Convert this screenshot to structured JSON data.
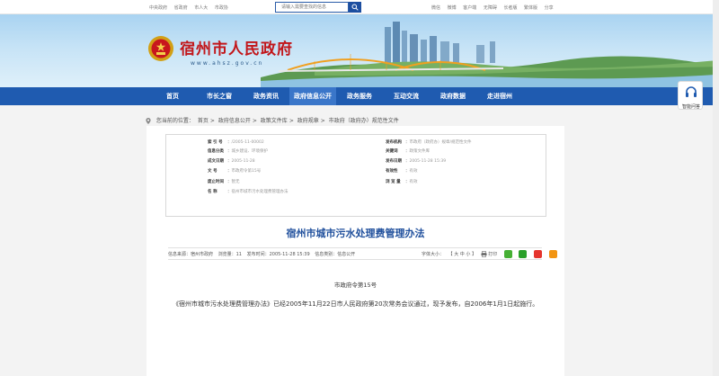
{
  "topbar": {
    "left": [
      "中央政府",
      "省政府",
      "市人大",
      "市政协"
    ],
    "search_placeholder": "请输入需要查找的信息",
    "right": [
      "微信",
      "微博",
      "客户端",
      "无障碍",
      "长者版",
      "繁体版",
      "分享"
    ]
  },
  "banner": {
    "title": "宿州市人民政府",
    "domain": "www.ahsz.gov.cn"
  },
  "nav": {
    "items": [
      "首页",
      "市长之窗",
      "政务资讯",
      "政府信息公开",
      "政务服务",
      "互动交流",
      "政府数据",
      "走进宿州"
    ],
    "active_index": 3
  },
  "float_service": {
    "label": "智能问答"
  },
  "breadcrumb": {
    "prefix": "您当前的位置：",
    "items": [
      "首页",
      "政府信息公开",
      "政策文件库",
      "政府规章",
      "市政府（政府办）规范性文件"
    ]
  },
  "meta": {
    "left": [
      {
        "k": "索 引 号",
        "v": "/2005-11-00002"
      },
      {
        "k": "信息分类",
        "v": "城乡建设、环境保护"
      },
      {
        "k": "成文日期",
        "v": "2005-11-28"
      },
      {
        "k": "文    号",
        "v": "市政府令第15号"
      },
      {
        "k": "废止时间",
        "v": "暂无"
      },
      {
        "k": "名    称",
        "v": "宿州市城市污水处理费管理办法"
      }
    ],
    "right": [
      {
        "k": "发布机构",
        "v": "市政府（政府办）规章/规范性文件"
      },
      {
        "k": "关键词",
        "v": "政策文件库"
      },
      {
        "k": "发布日期",
        "v": "2005-11-28 15:39"
      },
      {
        "k": "有效性",
        "v": "有效"
      },
      {
        "k": "浏 览 量",
        "v": "有效"
      }
    ]
  },
  "doc": {
    "title": "宿州市城市污水处理费管理办法",
    "info_left": [
      "信息来源：宿州市政府",
      "浏览量：11",
      "发布时间：2005-11-28 15:39",
      "信息类别：信息公开"
    ],
    "info_right": [
      "字体大小：",
      "【 大 中 小 】",
      "打印"
    ],
    "order": "市政府令第15号",
    "paragraph": "《宿州市城市污水处理费管理办法》已经2005年11月22日市人民政府第20次常务会议通过，现予发布，自2006年1月1日起施行。"
  },
  "colors": {
    "nav": "#1f5bb0",
    "title_red": "#c2161a",
    "doc_title": "#1f4f9c"
  }
}
